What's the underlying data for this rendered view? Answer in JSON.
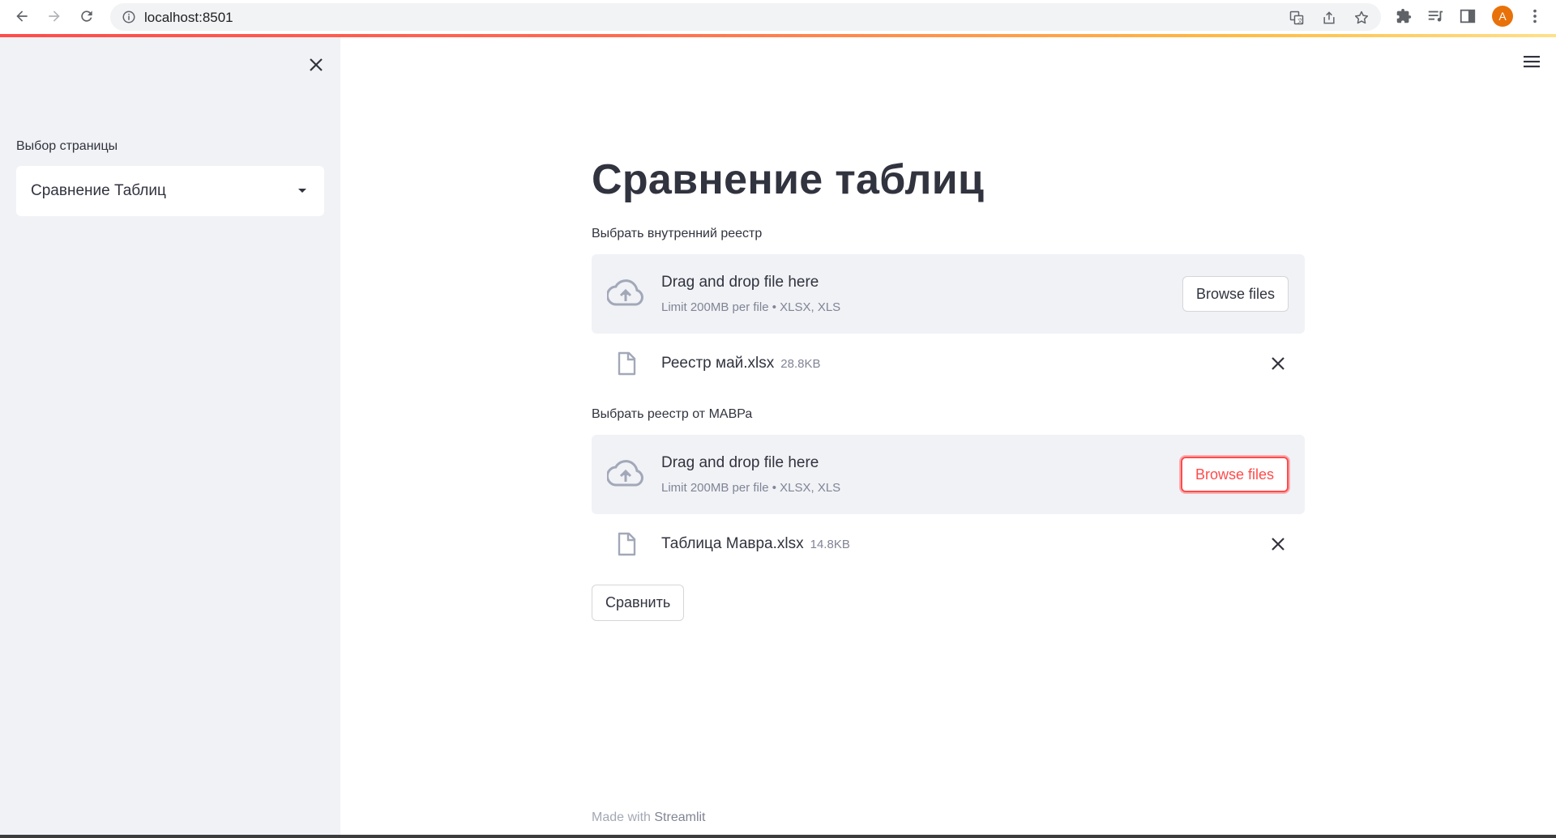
{
  "browser": {
    "url": "localhost:8501",
    "avatar_initial": "A"
  },
  "sidebar": {
    "select_label": "Выбор страницы",
    "select_value": "Сравнение Таблиц"
  },
  "main": {
    "title": "Сравнение таблиц",
    "uploaders": [
      {
        "label": "Выбрать внутренний реестр",
        "drop_title": "Drag and drop file here",
        "drop_subtitle": "Limit 200MB per file • XLSX, XLS",
        "browse_label": "Browse files",
        "file_name": "Реестр май.xlsx",
        "file_size": "28.8KB"
      },
      {
        "label": "Выбрать реестр от МАВРа",
        "drop_title": "Drag and drop file here",
        "drop_subtitle": "Limit 200MB per file • XLSX, XLS",
        "browse_label": "Browse files",
        "file_name": "Таблица Мавра.xlsx",
        "file_size": "14.8KB"
      }
    ],
    "compare_label": "Сравнить"
  },
  "footer": {
    "prefix": "Made with",
    "brand": "Streamlit"
  },
  "colors": {
    "accent": "#ff4b4b",
    "sidebar_bg": "#f0f2f6",
    "text": "#31333f"
  }
}
